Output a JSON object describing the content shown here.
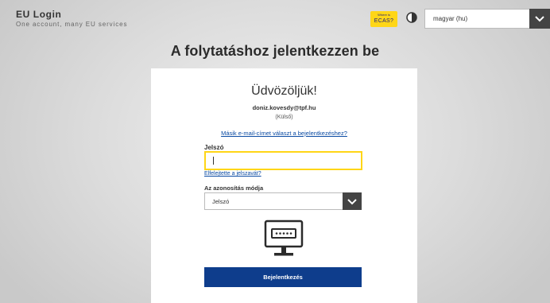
{
  "header": {
    "brand_title": "EU Login",
    "brand_subtitle": "One account, many EU services",
    "ecas_badge": {
      "line1": "Where is",
      "line2": "ECAS?"
    },
    "contrast_icon": "contrast-icon",
    "language": {
      "selected": "magyar (hu)"
    }
  },
  "page_title": "A folytatáshoz jelentkezzen be",
  "card": {
    "welcome": "Üdvözöljük!",
    "email": "doniz.kovesdy@tpf.hu",
    "account_type": "(Külső)",
    "other_email_link": "Másik e-mail-címet választ a bejelentkezéshez?",
    "password_label": "Jelszó",
    "password_value": "",
    "forgot_link": "Elfelejtette a jelszavát?",
    "auth_method_label": "Az azonosítás módja",
    "auth_method_selected": "Jelszó",
    "method_icon": "monitor-password-icon",
    "login_button": "Bejelentkezés"
  },
  "colors": {
    "accent_yellow": "#ffd617",
    "primary_blue": "#0e3d8c",
    "link_blue": "#0b4ba3",
    "dark_gray": "#444444"
  }
}
